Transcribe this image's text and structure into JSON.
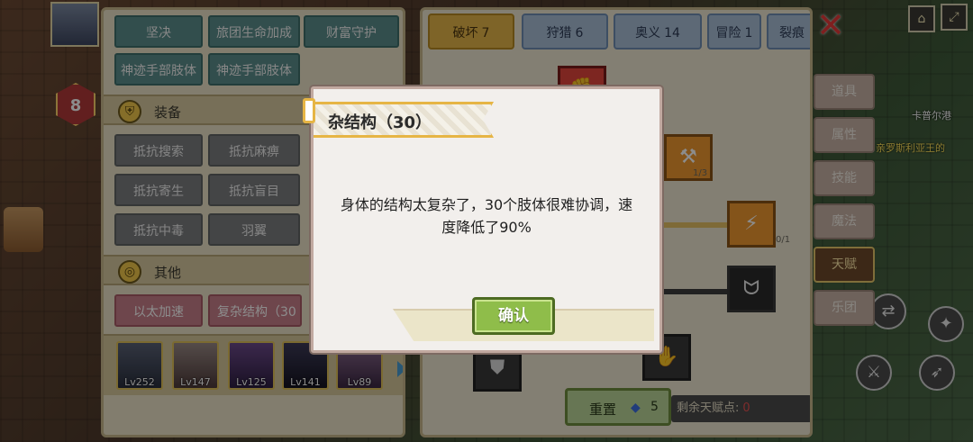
{
  "background_map": {
    "level_badge": "8",
    "place_name": "卡普尔港",
    "quest_text": "亲罗斯利亚王的",
    "team_members": [
      {
        "level": "Lv252"
      },
      {
        "level": "Lv147"
      },
      {
        "level": "Lv125"
      },
      {
        "level": "Lv141"
      },
      {
        "level": "Lv89"
      }
    ]
  },
  "skills_panel": {
    "top_chips": [
      "坚决",
      "旅团生命加成",
      "财富守护",
      "神迹手部肢体",
      "神迹手部肢体"
    ],
    "equipment_section": {
      "title": "装备",
      "chips": [
        "抵抗搜索",
        "抵抗麻痹",
        "抵抗寄生",
        "抵抗盲目",
        "抵抗中毒",
        "羽翼"
      ]
    },
    "other_section": {
      "title": "其他",
      "chips": [
        "以太加速",
        "复杂结构（30"
      ]
    }
  },
  "talent_panel": {
    "tabs": [
      {
        "label": "破坏",
        "count": "7"
      },
      {
        "label": "狩猎",
        "count": "6"
      },
      {
        "label": "奥义",
        "count": "14"
      },
      {
        "label": "冒险",
        "count": "1"
      },
      {
        "label": "裂痕",
        "count": ""
      }
    ],
    "node_counts": [
      "1/3",
      "0/1"
    ],
    "reset_button": {
      "label": "重置",
      "cost": "5"
    },
    "remaining_points_label": "剩余天赋点:",
    "remaining_points_value": "0"
  },
  "side_menu": [
    "道具",
    "属性",
    "技能",
    "魔法",
    "天赋",
    "乐团"
  ],
  "active_side_menu": "天赋",
  "dialog": {
    "title": "杂结构（30）",
    "body": "身体的结构太复杂了，30个肢体很难协调，速度降低了90%",
    "confirm_label": "确认"
  },
  "colors": {
    "accent_gold": "#e6b545",
    "confirm_green": "#8fbd4a",
    "close_red": "#e83a3a"
  }
}
